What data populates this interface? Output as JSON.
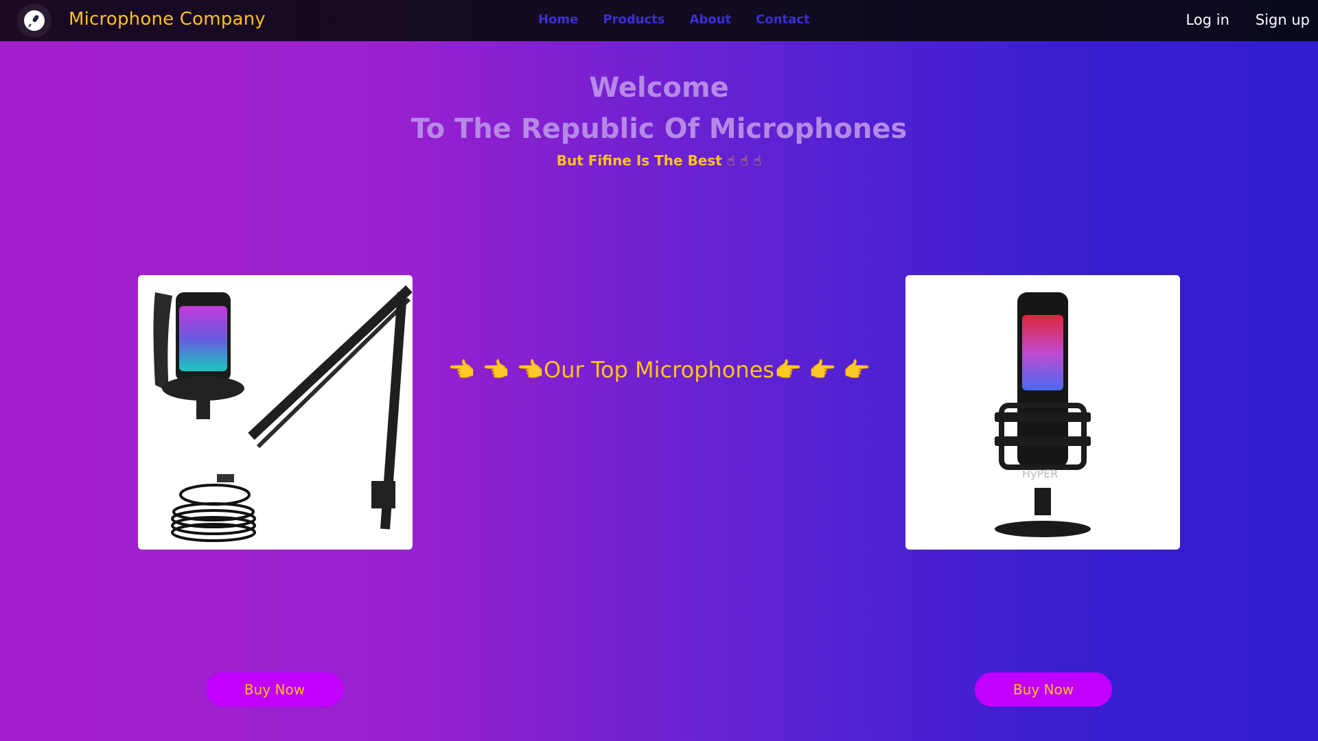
{
  "header": {
    "brand": "Microphone Company",
    "nav": [
      "Home",
      "Products",
      "About",
      "Contact"
    ],
    "login": "Log in",
    "signup": "Sign up"
  },
  "hero": {
    "line1": "Welcome",
    "line2": "To The Republic Of Microphones",
    "tagline": "But Fifine Is The Best ☝ ☝ ☝"
  },
  "products": {
    "heading": "👈 👈 👈Our Top Microphones👉 👉 👉",
    "left_button": "Buy Now",
    "right_button": "Buy Now"
  },
  "colors": {
    "brand": "#ffc21a",
    "nav_link": "#3b2fd6",
    "button": "#c100ff"
  }
}
